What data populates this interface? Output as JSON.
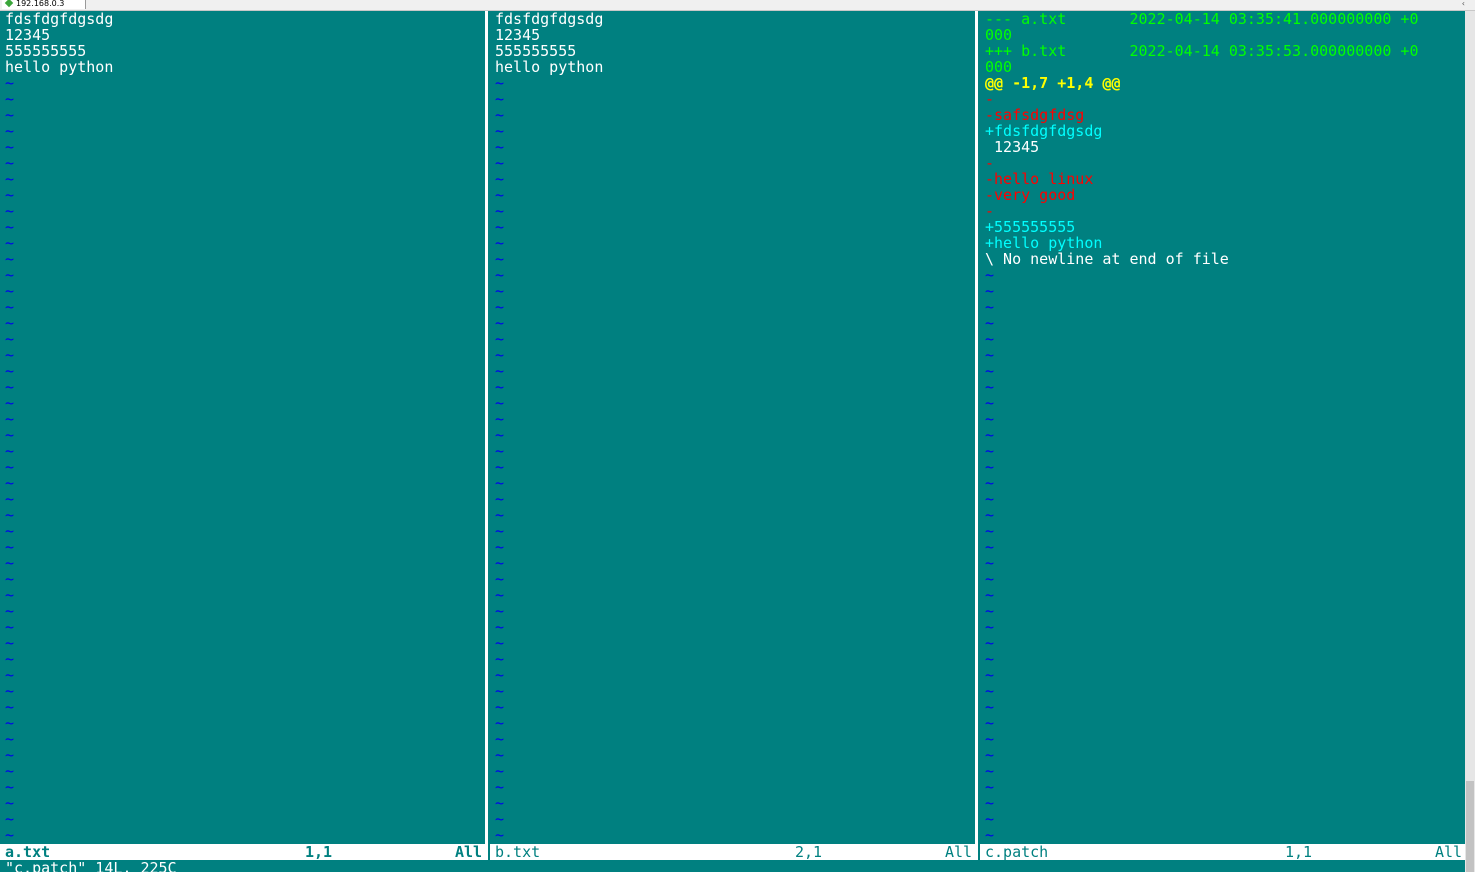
{
  "tab": {
    "title": "192.168.0.3"
  },
  "panes": [
    {
      "file": "a.txt",
      "position": "1,1",
      "scroll": "All",
      "active": true,
      "lines": [
        {
          "text": "fdsfdgfdgsdg",
          "kind": "plain"
        },
        {
          "text": "12345",
          "kind": "plain"
        },
        {
          "text": "555555555",
          "kind": "plain"
        },
        {
          "text": "hello python",
          "kind": "plain"
        }
      ]
    },
    {
      "file": "b.txt",
      "position": "2,1",
      "scroll": "All",
      "active": false,
      "lines": [
        {
          "text": "fdsfdgfdgsdg",
          "kind": "plain"
        },
        {
          "text": "12345",
          "kind": "plain"
        },
        {
          "text": "555555555",
          "kind": "plain"
        },
        {
          "text": "hello python",
          "kind": "plain"
        }
      ]
    },
    {
      "file": "c.patch",
      "position": "1,1",
      "scroll": "All",
      "active": false,
      "lines": [
        {
          "text": "--- a.txt       2022-04-14 03:35:41.000000000 +0",
          "kind": "diff-hdr"
        },
        {
          "text": "000",
          "kind": "diff-hdr"
        },
        {
          "text": "+++ b.txt       2022-04-14 03:35:53.000000000 +0",
          "kind": "diff-hdr"
        },
        {
          "text": "000",
          "kind": "diff-hdr"
        },
        {
          "text": "@@ -1,7 +1,4 @@",
          "kind": "diff-hunk"
        },
        {
          "text": "-",
          "kind": "diff-del"
        },
        {
          "text": "-safsdgfdsg",
          "kind": "diff-del"
        },
        {
          "text": "+fdsfdgfdgsdg",
          "kind": "diff-add"
        },
        {
          "text": " 12345",
          "kind": "diff-plain"
        },
        {
          "text": "-",
          "kind": "diff-del"
        },
        {
          "text": "-hello linux",
          "kind": "diff-del"
        },
        {
          "text": "-very good",
          "kind": "diff-del"
        },
        {
          "text": "-",
          "kind": "diff-del"
        },
        {
          "text": "+555555555",
          "kind": "diff-add"
        },
        {
          "text": "+hello python",
          "kind": "diff-add"
        },
        {
          "text": "\\ No newline at end of file",
          "kind": "diff-plain"
        }
      ]
    }
  ],
  "tilde_char": "~",
  "command_line": "\"c.patch\" 14L, 225C",
  "colors": {
    "background": "#008080",
    "tilde": "#0000ee",
    "diff_header": "#00ff00",
    "diff_hunk": "#ffff00",
    "diff_removed": "#ff0000",
    "diff_added": "#00ffff",
    "statusline_bg": "#ffffff",
    "statusline_fg": "#008080"
  }
}
